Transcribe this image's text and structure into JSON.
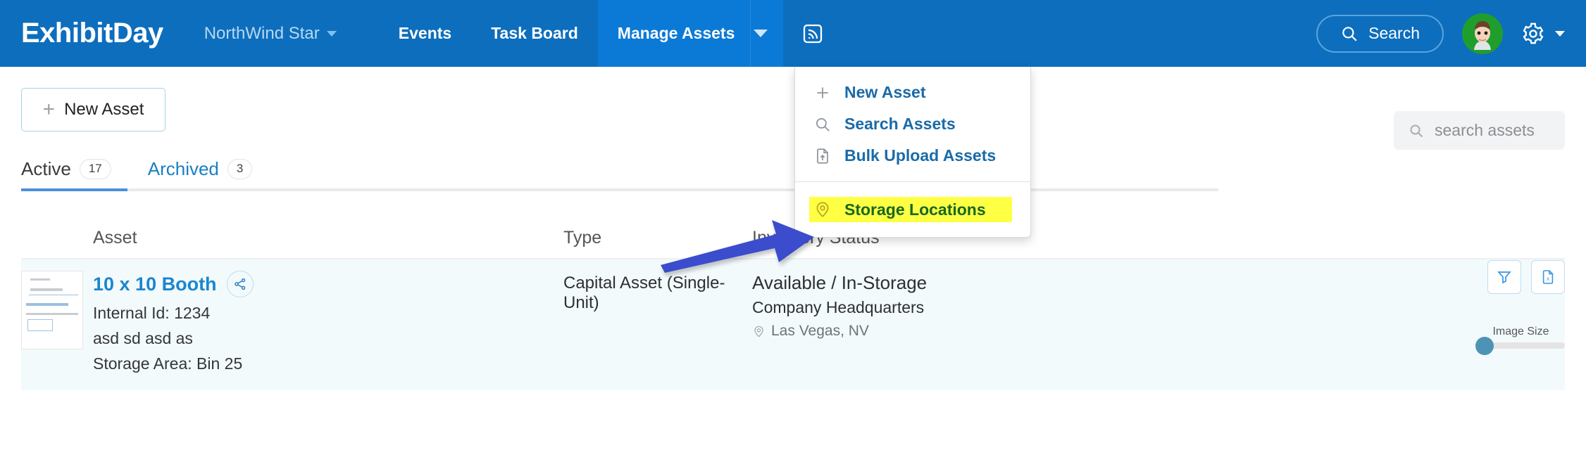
{
  "header": {
    "brand": "ExhibitDay",
    "org_name": "NorthWind Star",
    "nav": [
      {
        "label": "Events"
      },
      {
        "label": "Task Board"
      },
      {
        "label": "Manage Assets"
      }
    ],
    "rss_icon": "rss-feed-icon",
    "search_label": "Search",
    "search_icon": "search-icon",
    "avatar": "user-avatar",
    "gear_icon": "gear-icon",
    "accent_blue": "#0d6ebd",
    "active_tab_blue": "#0b7ad6"
  },
  "dropdown": {
    "items": [
      {
        "label": "New Asset",
        "icon": "plus-icon",
        "highlighted": false
      },
      {
        "label": "Search Assets",
        "icon": "search-icon",
        "highlighted": false
      },
      {
        "label": "Bulk Upload Assets",
        "icon": "file-upload-icon",
        "highlighted": false
      },
      {
        "label": "Storage Locations",
        "icon": "map-pin-icon",
        "highlighted": true
      }
    ],
    "highlight_color": "#ffff44",
    "highlight_text_color": "#16681f"
  },
  "annotation": {
    "arrow_color": "#3b4ecc",
    "points_to": "Storage Locations"
  },
  "toolbar": {
    "new_asset_label": "New Asset",
    "new_asset_icon": "plus-icon",
    "search_assets_placeholder": "search assets",
    "search_assets_icon": "search-icon",
    "filter_icon": "filter-funnel-icon",
    "export_icon": "export-excel-icon"
  },
  "tabs": [
    {
      "label": "Active",
      "count": "17",
      "selected": true
    },
    {
      "label": "Archived",
      "count": "3",
      "selected": false
    }
  ],
  "image_size": {
    "label": "Image Size",
    "value": 0
  },
  "table": {
    "columns": [
      "Asset",
      "Type",
      "Inventory Status"
    ],
    "rows": [
      {
        "thumbnail": "asset-thumbnail",
        "title": "10 x 10 Booth",
        "share_icon": "share-icon",
        "internal_id": "Internal Id: 1234",
        "description": "asd sd asd as",
        "storage_area": "Storage Area: Bin 25",
        "type": "Capital Asset (Single-Unit)",
        "inventory_status": "Available / In-Storage",
        "inventory_location": "Company Headquarters",
        "inventory_city": "Las Vegas, NV",
        "location_icon": "map-pin-icon"
      }
    ]
  }
}
